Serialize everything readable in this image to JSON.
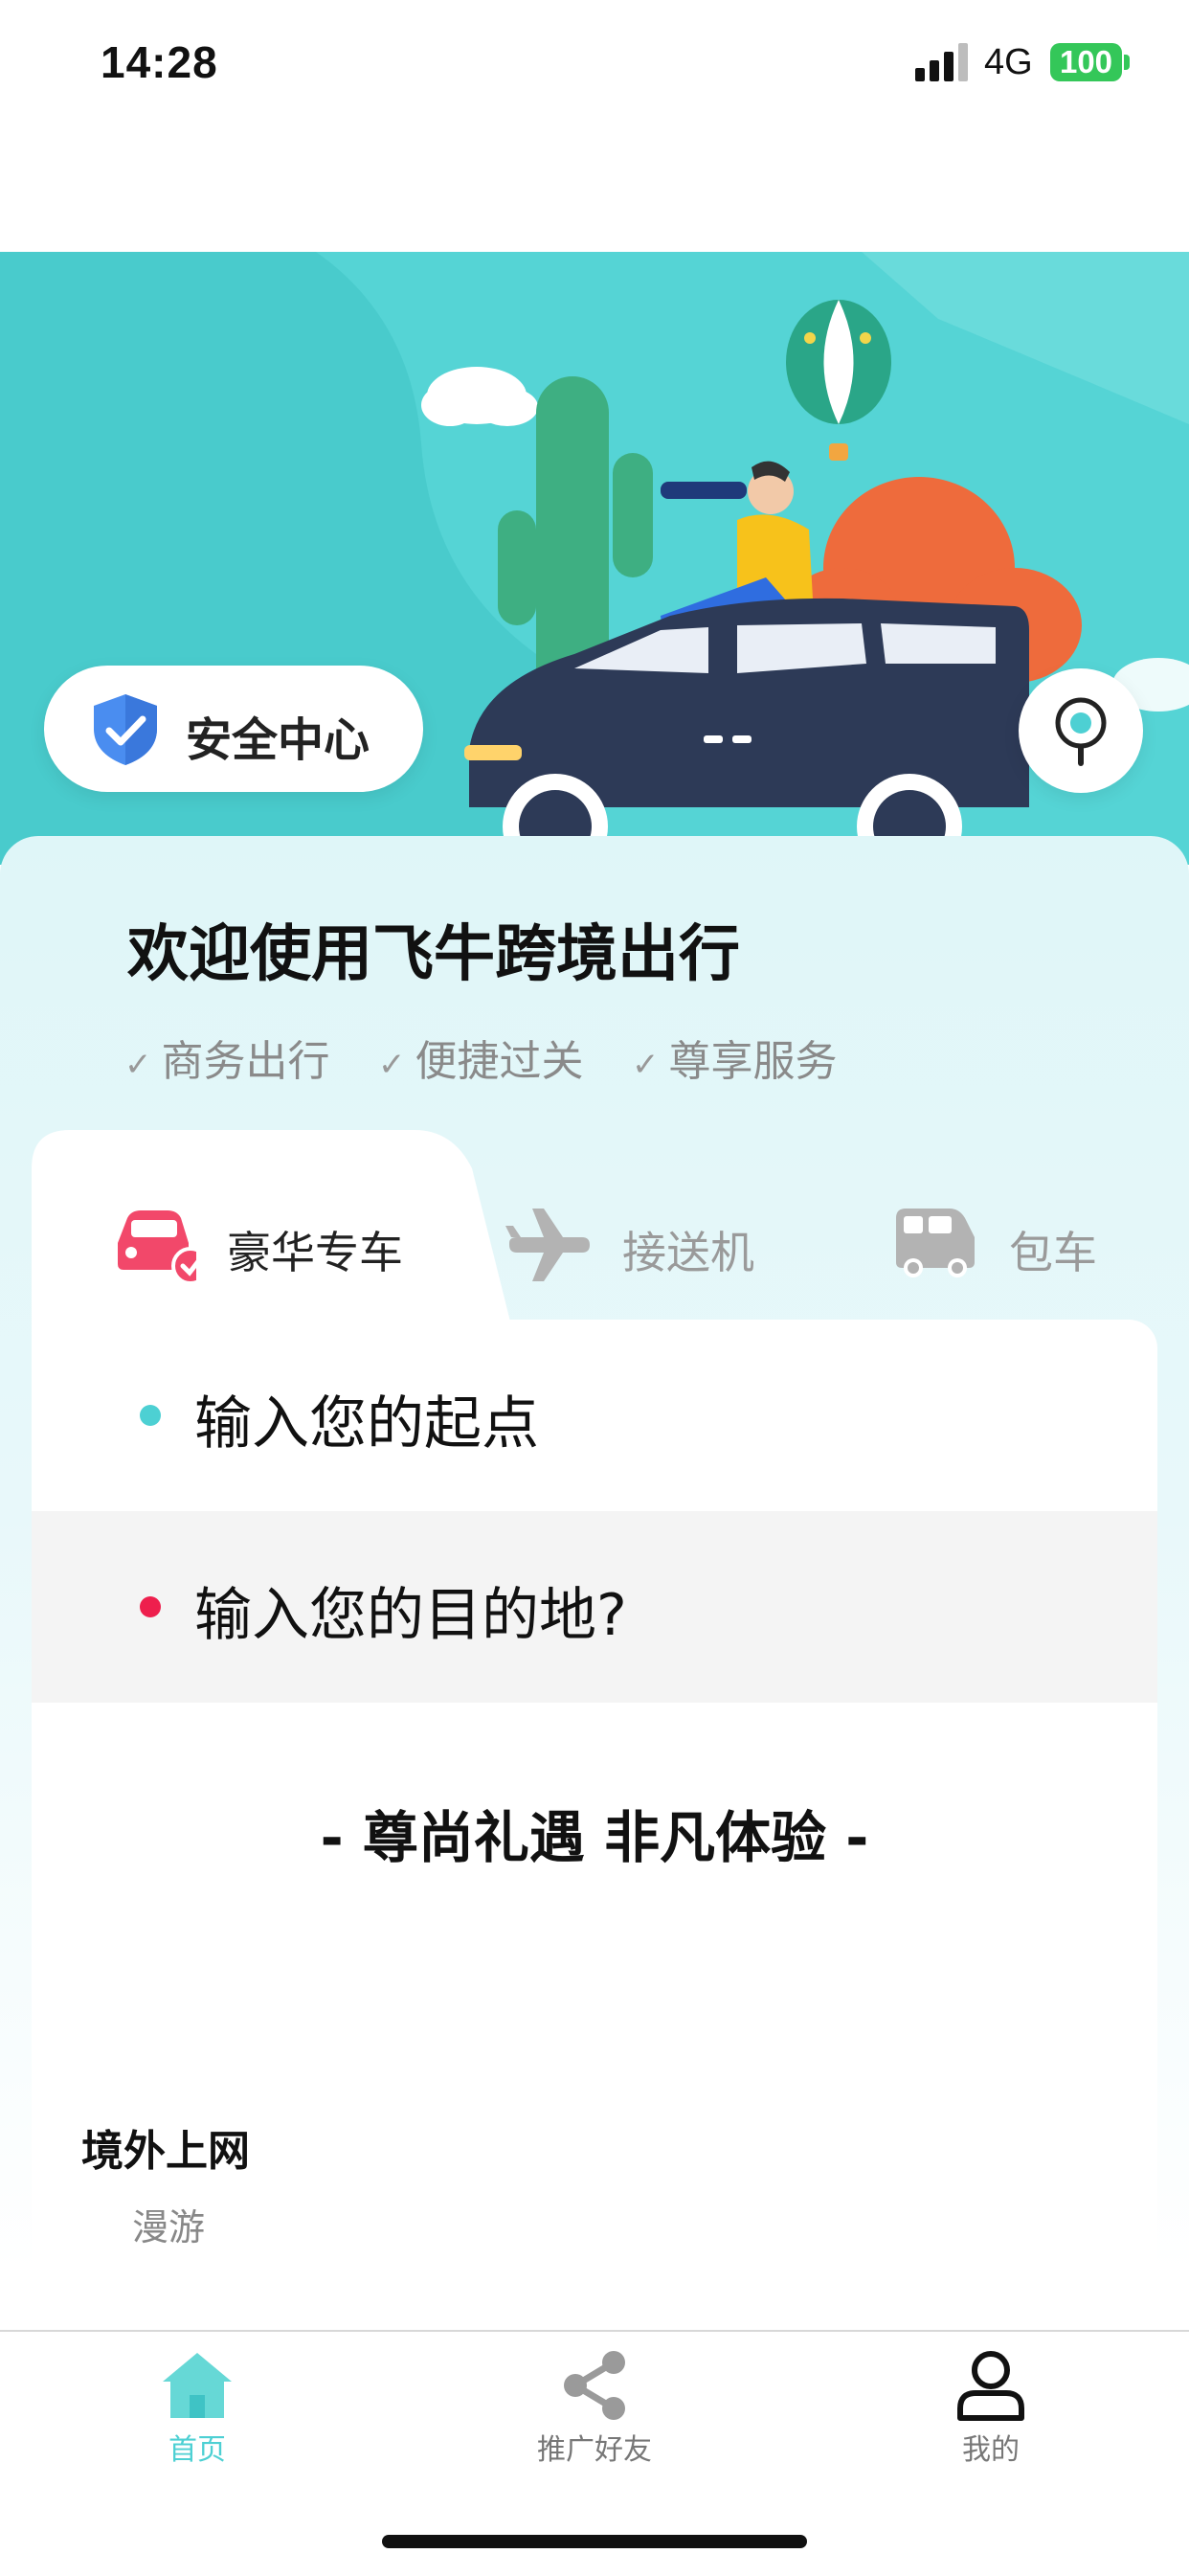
{
  "status_bar": {
    "time": "14:28",
    "network": "4G",
    "battery": "100"
  },
  "hero": {
    "safety_center_label": "安全中心"
  },
  "welcome": {
    "title": "欢迎使用飞牛跨境出行",
    "features": [
      "商务出行",
      "便捷过关",
      "尊享服务"
    ]
  },
  "service_tabs": [
    {
      "label": "豪华专车",
      "icon": "car-icon",
      "active": true
    },
    {
      "label": "接送机",
      "icon": "airplane-icon",
      "active": false
    },
    {
      "label": "包车",
      "icon": "van-icon",
      "active": false
    }
  ],
  "inputs": {
    "origin_placeholder": "输入您的起点",
    "destination_placeholder": "输入您的目的地?"
  },
  "slogan": "- 尊尚礼遇 非凡体验 -",
  "roaming": {
    "title": "境外上网",
    "subtitle": "漫游"
  },
  "bottom_nav": [
    {
      "label": "首页",
      "icon": "home-icon",
      "active": true
    },
    {
      "label": "推广好友",
      "icon": "share-icon",
      "active": false
    },
    {
      "label": "我的",
      "icon": "profile-icon",
      "active": false
    }
  ],
  "colors": {
    "accent_teal": "#4dd0d3",
    "destination_dot": "#ee1f4d",
    "active_tab_icon": "#f2486a",
    "inactive_gray": "#b3b3b3",
    "battery_green": "#34c759"
  }
}
